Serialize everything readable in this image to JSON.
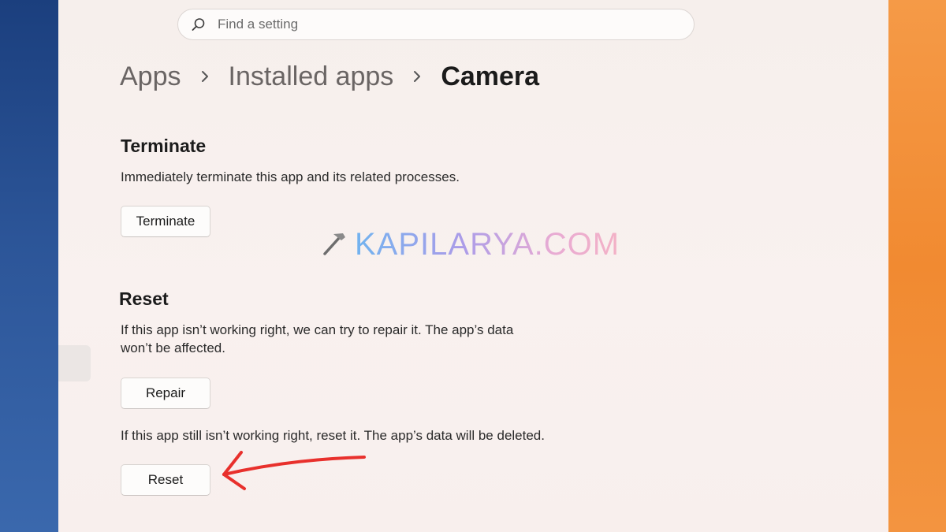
{
  "search": {
    "placeholder": "Find a setting"
  },
  "breadcrumb": [
    "Apps",
    "Installed apps",
    "Camera"
  ],
  "terminate": {
    "title": "Terminate",
    "description": "Immediately terminate this app and its related processes.",
    "button": "Terminate"
  },
  "reset": {
    "title": "Reset",
    "repair_description_line1": "If this app isn’t working right, we can try to repair it. The app’s data",
    "repair_description_line2": "won’t be affected.",
    "repair_button": "Repair",
    "reset_description": "If this app still isn’t working right, reset it. The app’s data will be deleted.",
    "reset_button": "Reset"
  },
  "watermark": {
    "text": "KAPILARYA.COM"
  },
  "colors": {
    "annotation_arrow": "#e8302c",
    "left_wallpaper": "#2c5598",
    "right_wallpaper": "#f18a31"
  },
  "icons": {
    "search": "search-icon",
    "separator": "chevron-right-icon",
    "watermark": "hammer-icon"
  }
}
